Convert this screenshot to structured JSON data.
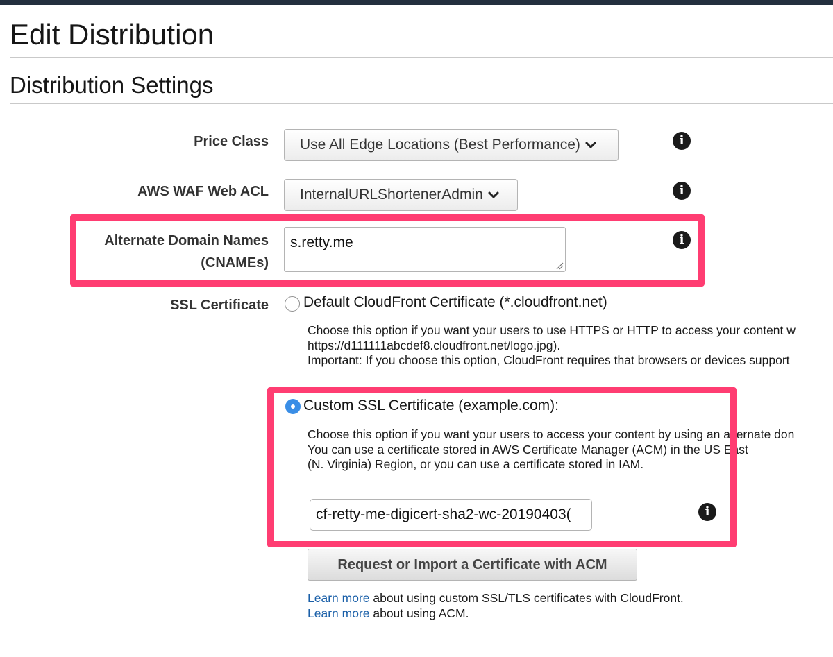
{
  "page": {
    "title": "Edit Distribution",
    "section_title": "Distribution Settings"
  },
  "price_class": {
    "label": "Price Class",
    "value": "Use All Edge Locations (Best Performance)"
  },
  "waf": {
    "label": "AWS WAF Web ACL",
    "value": "InternalURLShortenerAdmin"
  },
  "cnames": {
    "label_line1": "Alternate Domain Names",
    "label_line2": "(CNAMEs)",
    "value": "s.retty.me"
  },
  "ssl": {
    "label": "SSL Certificate",
    "default_option": {
      "label": "Default CloudFront Certificate (*.cloudfront.net)",
      "checked": false,
      "desc_line1": "Choose this option if you want your users to use HTTPS or HTTP to access your content w",
      "desc_line2": "https://d111111abcdef8.cloudfront.net/logo.jpg).",
      "desc_line3": "Important: If you choose this option, CloudFront requires that browsers or devices support"
    },
    "custom_option": {
      "label": "Custom SSL Certificate (example.com):",
      "checked": true,
      "desc_line1": "Choose this option if you want your users to access your content by using an alternate don",
      "desc_line2": "You can use a certificate stored in AWS Certificate Manager (ACM) in the US East",
      "desc_line3": "(N. Virginia) Region, or you can use a certificate stored in IAM."
    },
    "certificate_value": "cf-retty-me-digicert-sha2-wc-20190403(",
    "acm_button": "Request or Import a Certificate with ACM"
  },
  "learn_more": {
    "link1": "Learn more",
    "text1": " about using custom SSL/TLS certificates with CloudFront.",
    "link2": "Learn more",
    "text2": " about using ACM."
  },
  "icons": {
    "info": "info-icon",
    "dropdown": "chevron-down-icon",
    "resize": "resize-grip-icon"
  },
  "colors": {
    "highlight": "#ff3d72",
    "radio_checked": "#3a8ee6",
    "link": "#1a5fa8",
    "topbar": "#232f3e"
  }
}
